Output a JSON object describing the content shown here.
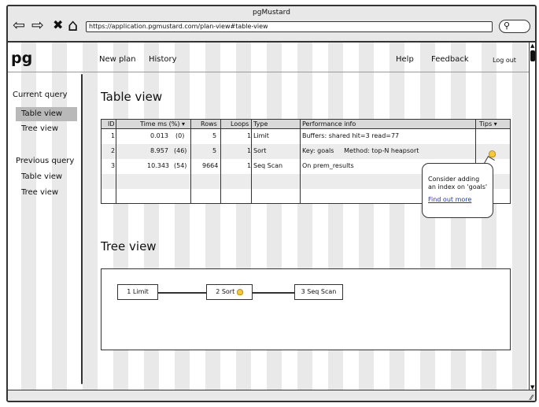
{
  "window": {
    "title": "pgMustard"
  },
  "browser": {
    "url": "https://application.pgmustard.com/plan-view#table-view",
    "back_icon": "⇦",
    "forward_icon": "⇨",
    "close_icon": "✖",
    "home_icon": "⌂",
    "search_icon": "🔍"
  },
  "nav": {
    "logo": "pg",
    "new_plan": "New plan",
    "history": "History",
    "help": "Help",
    "feedback": "Feedback",
    "logout": "Log out"
  },
  "sidebar": {
    "current_heading": "Current query",
    "current_items": [
      "Table view",
      "Tree view"
    ],
    "previous_heading": "Previous query",
    "previous_items": [
      "Table view",
      "Tree view"
    ]
  },
  "table_view": {
    "title": "Table view",
    "headers": {
      "id": "ID",
      "time": "Time ms (%) ▾",
      "rows": "Rows",
      "loops": "Loops",
      "type": "Type",
      "perf": "Performance info",
      "tips": "Tips ▾"
    },
    "rows": [
      {
        "id": "1",
        "time": "0.013",
        "pct": "(0)",
        "rows": "5",
        "loops": "1",
        "type": "Limit",
        "perf": "Buffers: shared hit=3 read=77",
        "tip": false
      },
      {
        "id": "2",
        "time": "8.957",
        "pct": "(46)",
        "rows": "5",
        "loops": "1",
        "type": "Sort",
        "perf": "Key: goals     Method: top-N heapsort",
        "tip": true
      },
      {
        "id": "3",
        "time": "10.343",
        "pct": "(54)",
        "rows": "9664",
        "loops": "1",
        "type": "Seq Scan",
        "perf": "On prem_results",
        "tip": false
      }
    ],
    "tooltip": {
      "text": "Consider adding an index on 'goals'",
      "link": "Find out more"
    }
  },
  "tree_view": {
    "title": "Tree view",
    "nodes": [
      "1 Limit",
      "2 Sort",
      "3 Seq Scan"
    ]
  },
  "colors": {
    "tip_bulb": "#f6c83a",
    "link": "#1a3bb0",
    "active_side": "#b9b9b9"
  }
}
